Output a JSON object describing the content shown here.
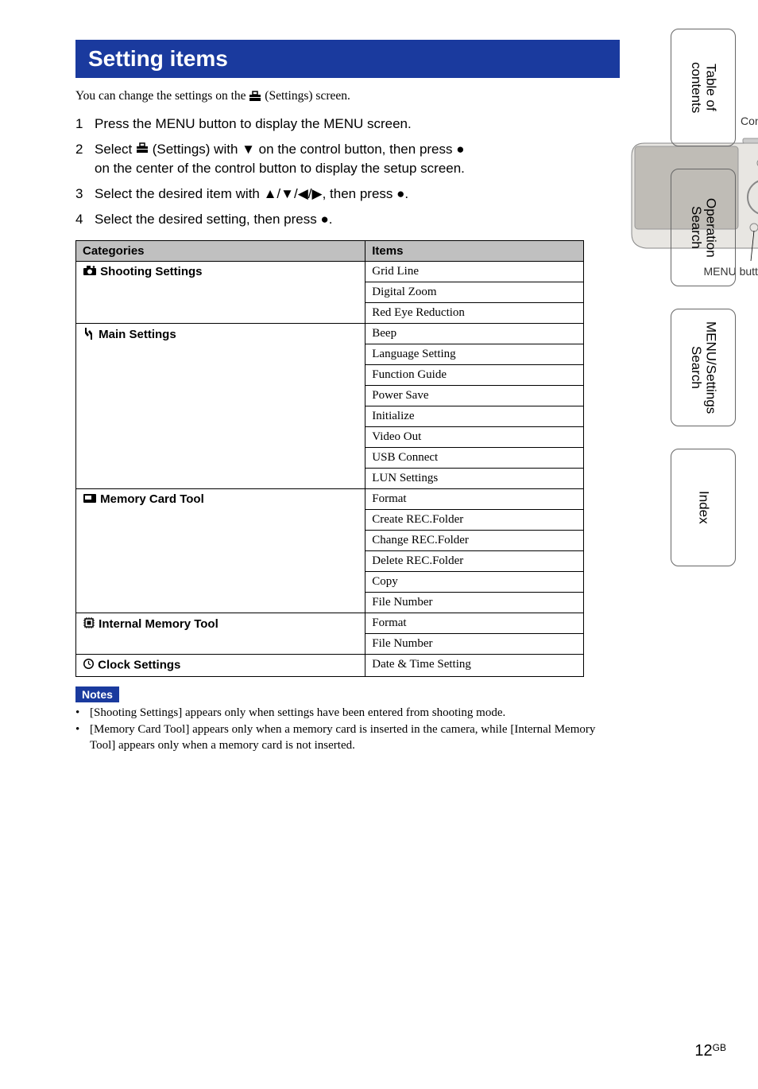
{
  "title": "Setting items",
  "intro_before": "You can change the settings on the ",
  "intro_after": " (Settings) screen.",
  "figure": {
    "control_button": "Control button",
    "menu_button": "MENU button"
  },
  "steps": [
    {
      "num": "1",
      "html": "Press the MENU button to display the MENU screen."
    },
    {
      "num": "2",
      "html": "Select {TOOLBOX} (Settings) with ▼ on the control button, then press ● on the center of the control button to display the setup screen."
    },
    {
      "num": "3",
      "html": "Select the desired item with ▲/▼/◀/▶, then press ●."
    },
    {
      "num": "4",
      "html": "Select the desired setting, then press ●."
    }
  ],
  "table": {
    "head": {
      "categories": "Categories",
      "items": "Items"
    },
    "rows": [
      {
        "icon": "camera",
        "category": "Shooting Settings",
        "items": [
          "Grid Line",
          "Digital Zoom",
          "Red Eye Reduction"
        ]
      },
      {
        "icon": "wrench",
        "category": "Main Settings",
        "items": [
          "Beep",
          "Language Setting",
          "Function Guide",
          "Power Save",
          "Initialize",
          "Video Out",
          "USB Connect",
          "LUN Settings"
        ]
      },
      {
        "icon": "card",
        "category": "Memory Card Tool",
        "items": [
          "Format",
          "Create REC.Folder",
          "Change REC.Folder",
          "Delete REC.Folder",
          "Copy",
          "File Number"
        ]
      },
      {
        "icon": "chip",
        "category": "Internal Memory Tool",
        "items": [
          "Format",
          "File Number"
        ]
      },
      {
        "icon": "clock",
        "category": "Clock Settings",
        "items": [
          "Date & Time Setting"
        ]
      }
    ]
  },
  "notes_label": "Notes",
  "notes": [
    "[Shooting Settings] appears only when settings have been entered from shooting mode.",
    "[Memory Card Tool] appears only when a memory card is inserted in the camera, while [Internal Memory Tool] appears only when a memory card is not inserted."
  ],
  "tabs": [
    "Table of\ncontents",
    "Operation\nSearch",
    "MENU/Settings\nSearch",
    "Index"
  ],
  "page_number": "12",
  "page_suffix": "GB"
}
